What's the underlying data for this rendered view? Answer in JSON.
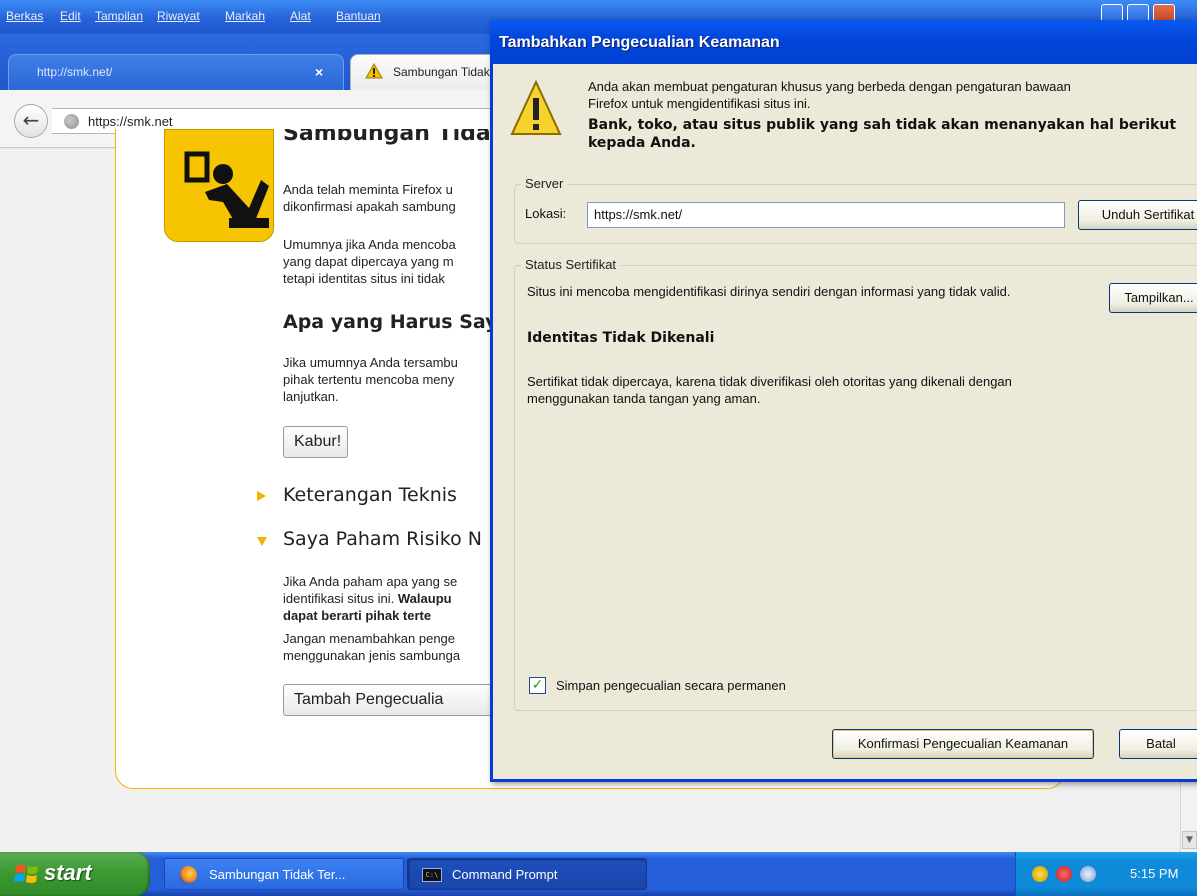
{
  "menu": [
    "Berkas",
    "Edit",
    "Tampilan",
    "Riwayat",
    "Markah",
    "Alat",
    "Bantuan"
  ],
  "tabs": [
    {
      "label": "http://smk.net/",
      "close": "×"
    },
    {
      "label": "Sambungan Tidak Terpercaya"
    }
  ],
  "nav": {
    "back": "←",
    "url": "https://smk.net"
  },
  "page": {
    "heading": "Sambungan Tidak Terpercaya",
    "p1": "Anda telah meminta Firefox u\ndikonfirmasi apakah sambung",
    "p2": "Umumnya jika Anda mencoba\nyang dapat dipercaya yang m\ntetapi identitas situs ini tidak",
    "h_what": "Apa yang Harus Saya",
    "p3": "Jika umumnya Anda tersambu\npihak tertentu mencoba meny\nlanjutkan.",
    "btn_kabur": "Kabur!",
    "h_teknis": "Keterangan Teknis",
    "h_risiko": "Saya Paham Risiko N",
    "p4a": "Jika Anda paham apa yang se\nidentifikasi situs ini. ",
    "p4b": "Walaupu",
    "p4c": "dapat berarti pihak terte",
    "p5": "Jangan menambahkan penge\nmenggunakan jenis sambunga",
    "btn_tambah": "Tambah Pengecualia"
  },
  "dialog": {
    "title": "Tambahkan Pengecualian Keamanan",
    "intro": "Anda akan membuat pengaturan khusus yang berbeda dengan pengaturan bawaan\nFirefox untuk mengidentifikasi situs ini.",
    "warning": "Bank, toko, atau situs publik yang sah tidak akan menanyakan hal berikut\nkepada Anda.",
    "server_legend": "Server",
    "lokasi_label": "Lokasi:",
    "lokasi_value": "https://smk.net/",
    "unduh_btn": "Unduh Sertifikat",
    "status_legend": "Status Sertifikat",
    "status_text": "Situs ini mencoba mengidentifikasi dirinya sendiri dengan informasi yang tidak valid.",
    "tampilkan_btn": "Tampilkan...",
    "identitas": "Identitas Tidak Dikenali",
    "cert_desc": "Sertifikat tidak dipercaya, karena tidak diverifikasi oleh otoritas yang dikenali dengan\nmenggunakan tanda tangan yang aman.",
    "simpan_label": "Simpan pengecualian secara permanen",
    "simpan_checked": "✓",
    "konfirmasi_btn": "Konfirmasi Pengecualian Keamanan",
    "batal_btn": "Batal"
  },
  "taskbar": {
    "start": "start",
    "items": [
      "Sambungan Tidak Ter...",
      "Command Prompt"
    ],
    "cmd_icon": "C:\\",
    "clock": "5:15 PM"
  },
  "colors": {
    "xp_blue": "#245edb",
    "dialog_title": "#0346dc",
    "warning_yellow": "#f6c400",
    "start_green": "#3c9a33"
  }
}
